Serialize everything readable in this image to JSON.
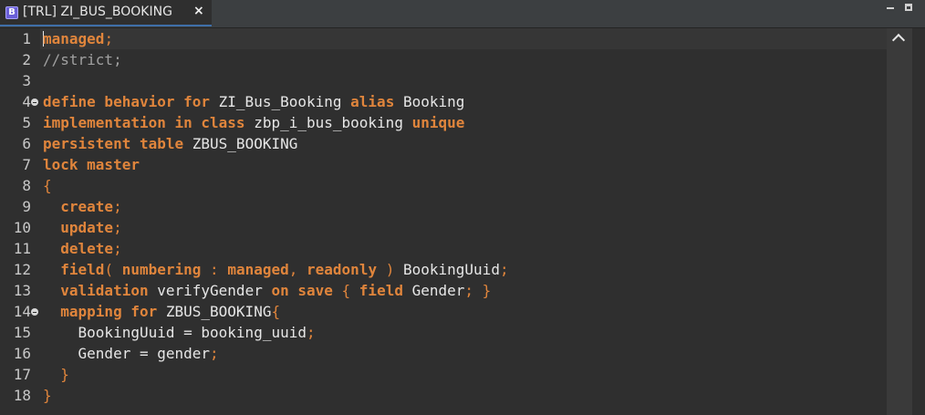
{
  "tab": {
    "icon_letter": "B",
    "title": "[TRL] ZI_BUS_BOOKING",
    "close_glyph": "×"
  },
  "editor": {
    "lines": [
      {
        "n": "1",
        "fold": false,
        "tokens": [
          {
            "t": "managed",
            "c": "kw"
          },
          {
            "t": ";",
            "c": "pu"
          }
        ]
      },
      {
        "n": "2",
        "fold": false,
        "tokens": [
          {
            "t": "//strict;",
            "c": "cm"
          }
        ]
      },
      {
        "n": "3",
        "fold": false,
        "tokens": []
      },
      {
        "n": "4",
        "fold": true,
        "tokens": [
          {
            "t": "define behavior for ",
            "c": "kw"
          },
          {
            "t": "ZI_Bus_Booking ",
            "c": "id"
          },
          {
            "t": "alias ",
            "c": "kw"
          },
          {
            "t": "Booking",
            "c": "id"
          }
        ]
      },
      {
        "n": "5",
        "fold": false,
        "tokens": [
          {
            "t": "implementation in class ",
            "c": "kw"
          },
          {
            "t": "zbp_i_bus_booking ",
            "c": "id"
          },
          {
            "t": "unique",
            "c": "kw"
          }
        ]
      },
      {
        "n": "6",
        "fold": false,
        "tokens": [
          {
            "t": "persistent table ",
            "c": "kw"
          },
          {
            "t": "ZBUS_BOOKING",
            "c": "id"
          }
        ]
      },
      {
        "n": "7",
        "fold": false,
        "tokens": [
          {
            "t": "lock master",
            "c": "kw"
          }
        ]
      },
      {
        "n": "8",
        "fold": false,
        "tokens": [
          {
            "t": "{",
            "c": "pu"
          }
        ]
      },
      {
        "n": "9",
        "fold": false,
        "tokens": [
          {
            "t": "  ",
            "c": "id"
          },
          {
            "t": "create",
            "c": "kw"
          },
          {
            "t": ";",
            "c": "pu"
          }
        ]
      },
      {
        "n": "10",
        "fold": false,
        "tokens": [
          {
            "t": "  ",
            "c": "id"
          },
          {
            "t": "update",
            "c": "kw"
          },
          {
            "t": ";",
            "c": "pu"
          }
        ]
      },
      {
        "n": "11",
        "fold": false,
        "tokens": [
          {
            "t": "  ",
            "c": "id"
          },
          {
            "t": "delete",
            "c": "kw"
          },
          {
            "t": ";",
            "c": "pu"
          }
        ]
      },
      {
        "n": "12",
        "fold": false,
        "tokens": [
          {
            "t": "  ",
            "c": "id"
          },
          {
            "t": "field",
            "c": "kw"
          },
          {
            "t": "( ",
            "c": "pu"
          },
          {
            "t": "numbering",
            "c": "kw"
          },
          {
            "t": " : ",
            "c": "pu"
          },
          {
            "t": "managed",
            "c": "kw"
          },
          {
            "t": ", ",
            "c": "pu"
          },
          {
            "t": "readonly",
            "c": "kw"
          },
          {
            "t": " ) ",
            "c": "pu"
          },
          {
            "t": "BookingUuid",
            "c": "id"
          },
          {
            "t": ";",
            "c": "pu"
          }
        ]
      },
      {
        "n": "13",
        "fold": false,
        "tokens": [
          {
            "t": "  ",
            "c": "id"
          },
          {
            "t": "validation ",
            "c": "kw"
          },
          {
            "t": "verifyGender ",
            "c": "id"
          },
          {
            "t": "on save ",
            "c": "kw"
          },
          {
            "t": "{ ",
            "c": "pu"
          },
          {
            "t": "field ",
            "c": "kw"
          },
          {
            "t": "Gender",
            "c": "id"
          },
          {
            "t": "; }",
            "c": "pu"
          }
        ]
      },
      {
        "n": "14",
        "fold": true,
        "tokens": [
          {
            "t": "  ",
            "c": "id"
          },
          {
            "t": "mapping for ",
            "c": "kw"
          },
          {
            "t": "ZBUS_BOOKING",
            "c": "id"
          },
          {
            "t": "{",
            "c": "pu"
          }
        ]
      },
      {
        "n": "15",
        "fold": false,
        "tokens": [
          {
            "t": "    BookingUuid ",
            "c": "id"
          },
          {
            "t": "= ",
            "c": "id"
          },
          {
            "t": "booking_uuid",
            "c": "id"
          },
          {
            "t": ";",
            "c": "pu"
          }
        ]
      },
      {
        "n": "16",
        "fold": false,
        "tokens": [
          {
            "t": "    Gender ",
            "c": "id"
          },
          {
            "t": "= ",
            "c": "id"
          },
          {
            "t": "gender",
            "c": "id"
          },
          {
            "t": ";",
            "c": "pu"
          }
        ]
      },
      {
        "n": "17",
        "fold": false,
        "tokens": [
          {
            "t": "  ",
            "c": "id"
          },
          {
            "t": "}",
            "c": "pu"
          }
        ]
      },
      {
        "n": "18",
        "fold": false,
        "tokens": [
          {
            "t": "}",
            "c": "pu"
          }
        ]
      }
    ]
  },
  "colors": {
    "keyword": "#e0853c",
    "identifier": "#e6e6e6",
    "comment": "#a0a0a0",
    "background": "#2f2f2f"
  },
  "icons": {
    "tab_icon": "behavior-definition-icon",
    "close": "close-icon",
    "fold": "fold-collapse-icon",
    "scroll_up": "chevron-up-icon",
    "minimize": "minimize-icon",
    "maximize": "maximize-icon"
  }
}
